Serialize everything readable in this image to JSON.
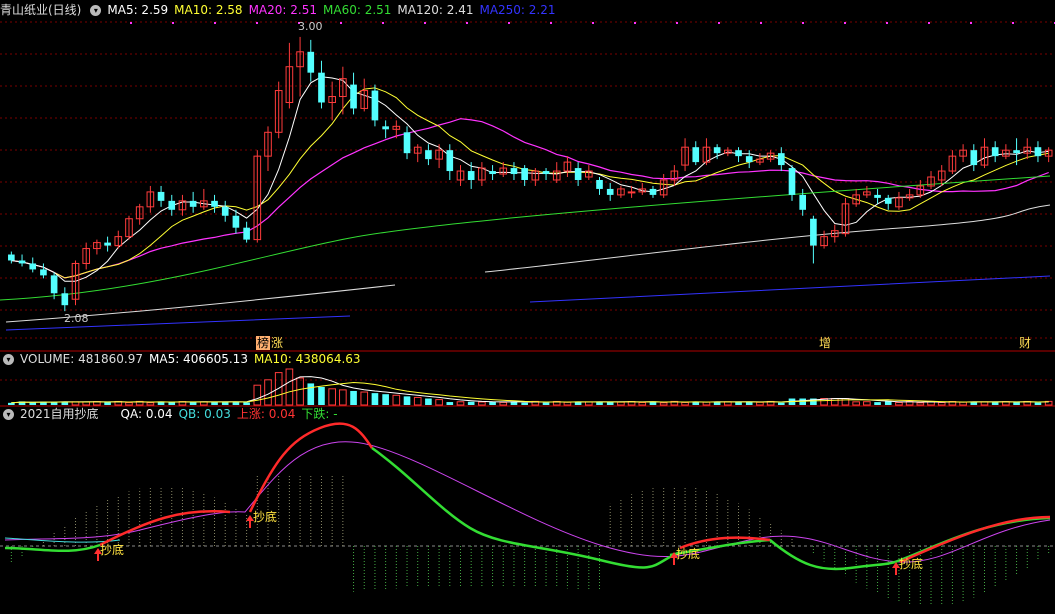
{
  "main_panel": {
    "title": "青山纸业(日线)",
    "indicators": [
      {
        "label": "MA5: 2.59",
        "color": "#ffffff"
      },
      {
        "label": "MA10: 2.58",
        "color": "#ffff33"
      },
      {
        "label": "MA20: 2.51",
        "color": "#ff33ff"
      },
      {
        "label": "MA60: 2.51",
        "color": "#33dd33"
      },
      {
        "label": "MA120: 2.41",
        "color": "#dddddd"
      },
      {
        "label": "MA250: 2.21",
        "color": "#3333ff"
      }
    ],
    "high_label": "3.00",
    "low_label": "2.08",
    "events": [
      {
        "text": "榜",
        "style": "boxed"
      },
      {
        "text": "涨",
        "style": "plain"
      },
      {
        "text": "增",
        "style": "plain"
      },
      {
        "text": "财",
        "style": "plain"
      }
    ]
  },
  "volume_panel": {
    "title": "VOLUME: 481860.97",
    "indicators": [
      {
        "label": "MA5: 406605.13",
        "color": "#ffffff"
      },
      {
        "label": "MA10: 438064.63",
        "color": "#ffff33"
      }
    ]
  },
  "indicator_panel": {
    "title": "2021自用抄底",
    "indicators": [
      {
        "label": "QA: 0.04",
        "color": "#ffffff"
      },
      {
        "label": "QB: 0.03",
        "color": "#44dddd"
      },
      {
        "label": "上涨: 0.04",
        "color": "#ff3333"
      },
      {
        "label": "下跌: -",
        "color": "#33dd33"
      }
    ],
    "signal_label": "抄底"
  },
  "colors": {
    "up": "#ff3c3c",
    "down": "#54ffff",
    "grid": "#7a0000",
    "ma5": "#ffffff",
    "ma10": "#ffff33",
    "ma20": "#ff33ff",
    "ma60": "#33dd33",
    "ma120": "#dddddd",
    "ma250": "#3333ff"
  },
  "icons": {
    "collapse": "chevron-down-icon"
  }
}
